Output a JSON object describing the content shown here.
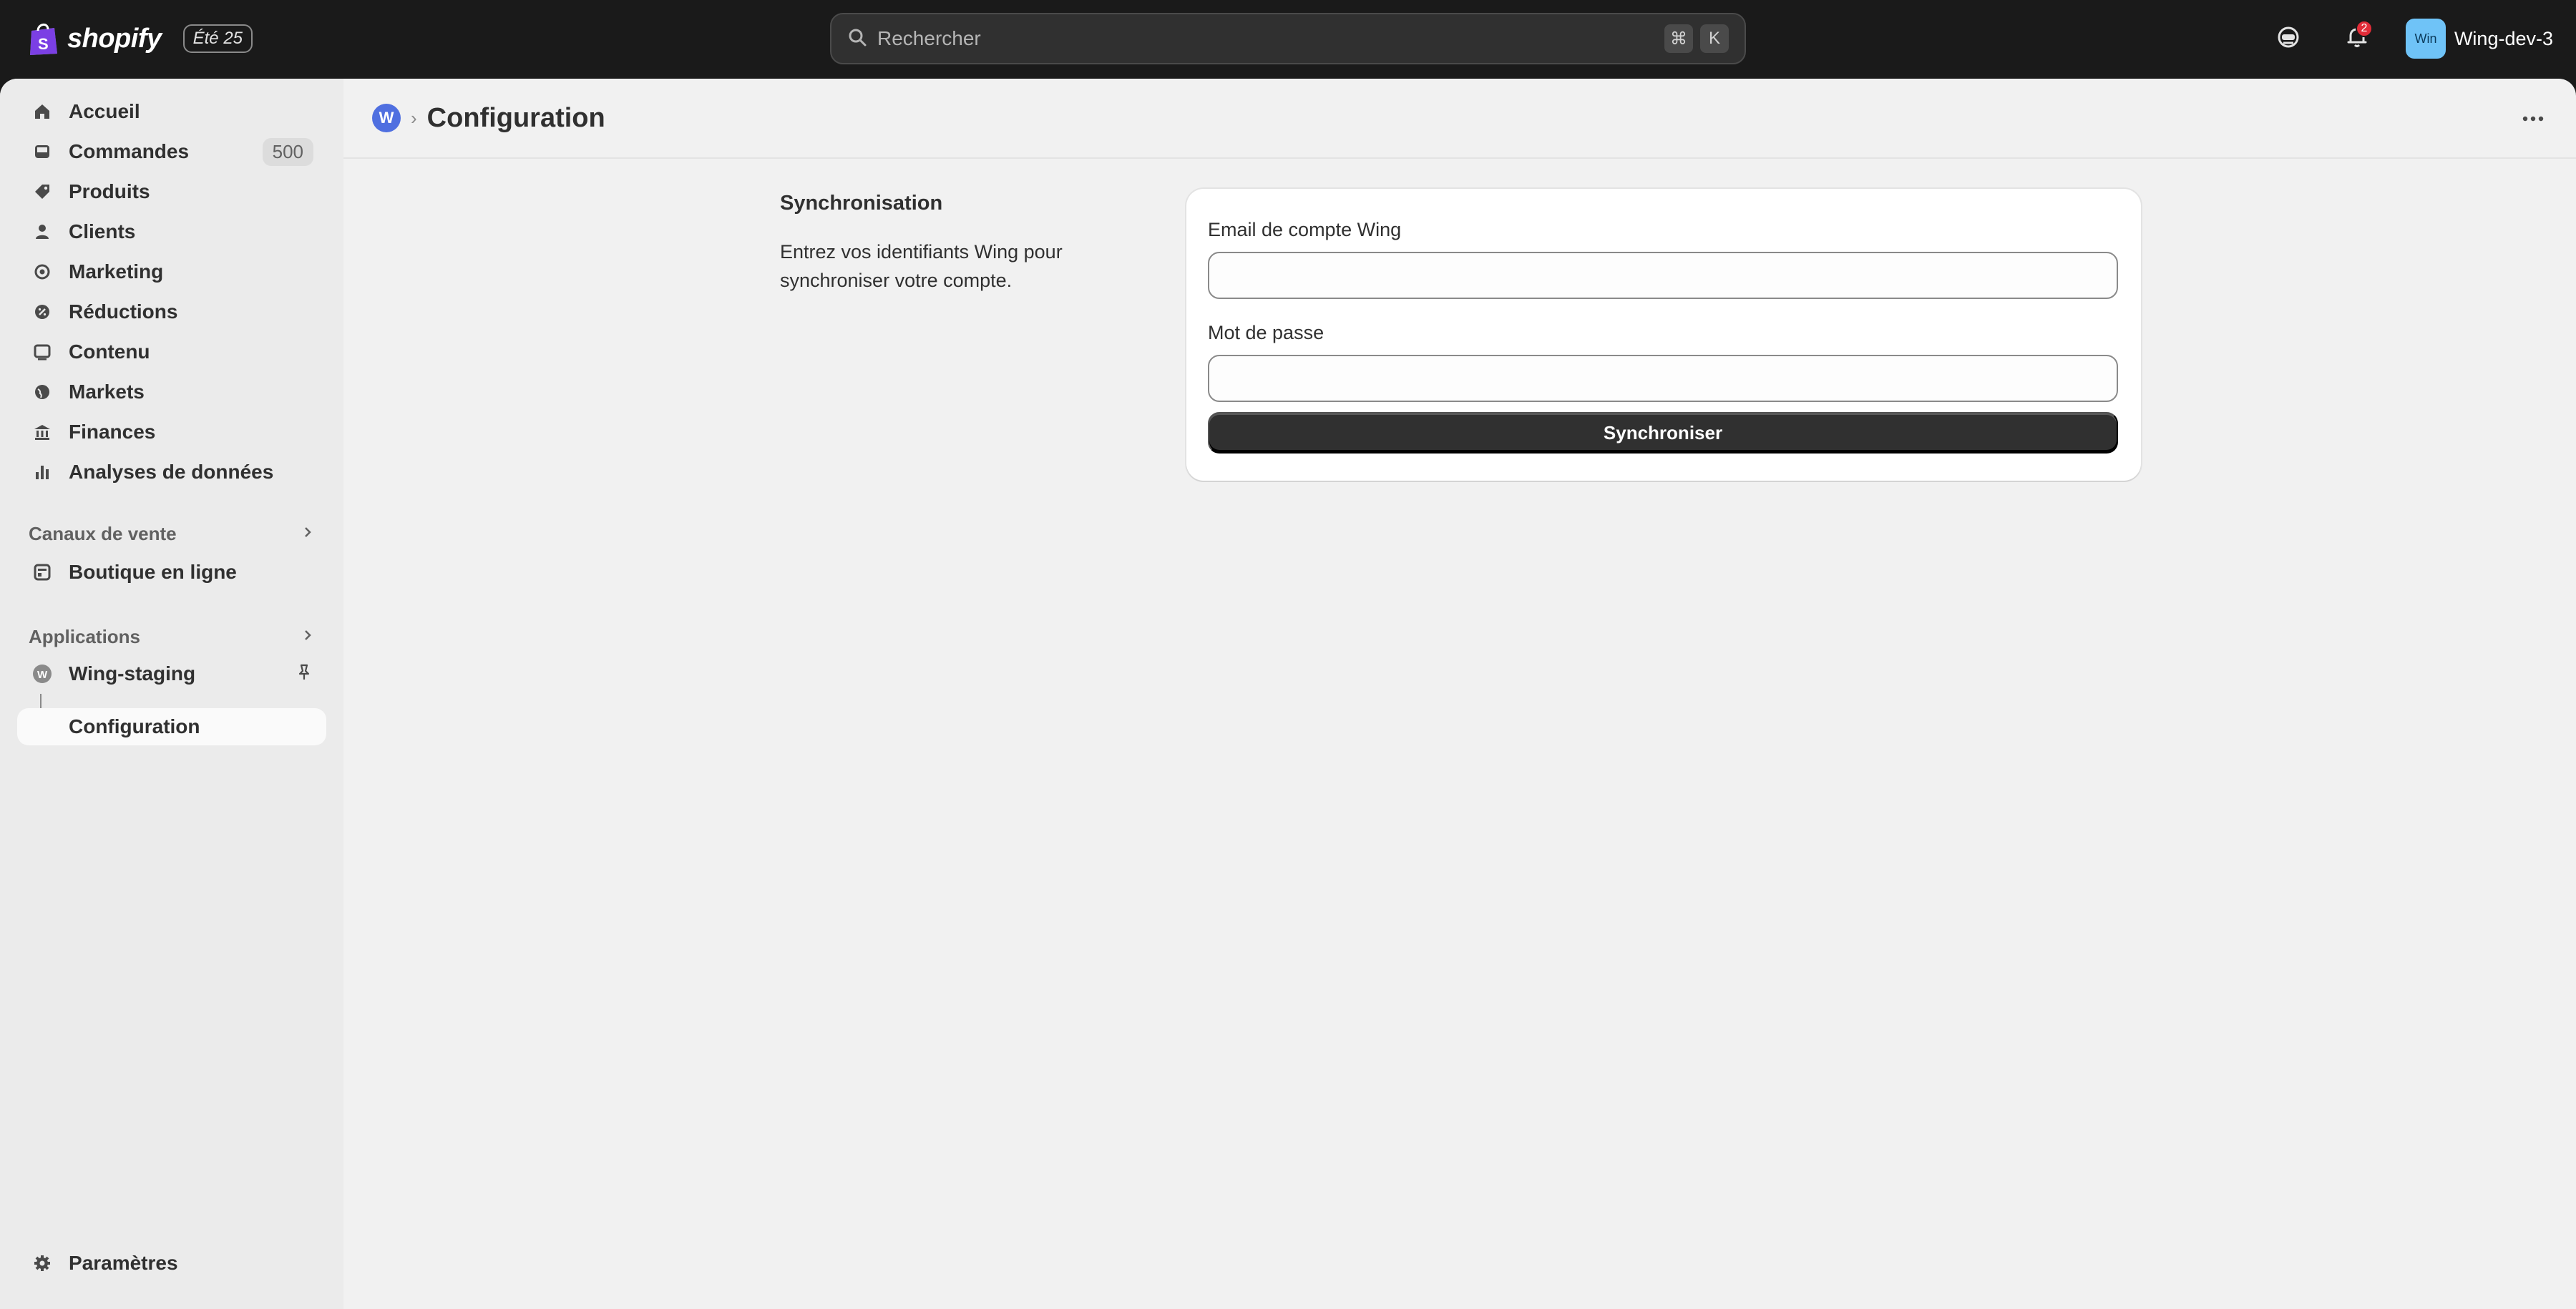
{
  "topbar": {
    "logo_text": "shopify",
    "edition": "Été 25",
    "search_placeholder": "Rechercher",
    "shortcut_keys": [
      "⌘",
      "K"
    ],
    "notification_count": "2",
    "account_initials": "Win",
    "account_name": "Wing-dev-3"
  },
  "sidebar": {
    "items": [
      {
        "label": "Accueil",
        "icon": "home-icon"
      },
      {
        "label": "Commandes",
        "icon": "inbox-icon",
        "count": "500"
      },
      {
        "label": "Produits",
        "icon": "tag-icon"
      },
      {
        "label": "Clients",
        "icon": "person-icon"
      },
      {
        "label": "Marketing",
        "icon": "target-icon"
      },
      {
        "label": "Réductions",
        "icon": "discount-icon"
      },
      {
        "label": "Contenu",
        "icon": "image-icon"
      },
      {
        "label": "Markets",
        "icon": "globe-icon"
      },
      {
        "label": "Finances",
        "icon": "bank-icon"
      },
      {
        "label": "Analyses de données",
        "icon": "chart-icon"
      }
    ],
    "sales_channels_label": "Canaux de vente",
    "sales_channels": [
      {
        "label": "Boutique en ligne",
        "icon": "store-icon"
      }
    ],
    "apps_label": "Applications",
    "app": {
      "label": "Wing-staging",
      "initial": "W"
    },
    "app_sub": {
      "label": "Configuration"
    },
    "settings_label": "Paramètres"
  },
  "header": {
    "app_initial": "W",
    "title": "Configuration"
  },
  "section": {
    "title": "Synchronisation",
    "description": "Entrez vos identifiants Wing pour synchroniser votre compte."
  },
  "form": {
    "email_label": "Email de compte Wing",
    "email_value": "",
    "password_label": "Mot de passe",
    "password_value": "",
    "submit_label": "Synchroniser"
  },
  "colors": {
    "topbar": "#1a1a1a",
    "page_bg": "#f1f1f1",
    "sidebar_bg": "#ebebeb",
    "primary_button": "#303030",
    "app_badge": "#4f6fe0",
    "avatar": "#6fc3f7",
    "notification": "#e22c38"
  }
}
